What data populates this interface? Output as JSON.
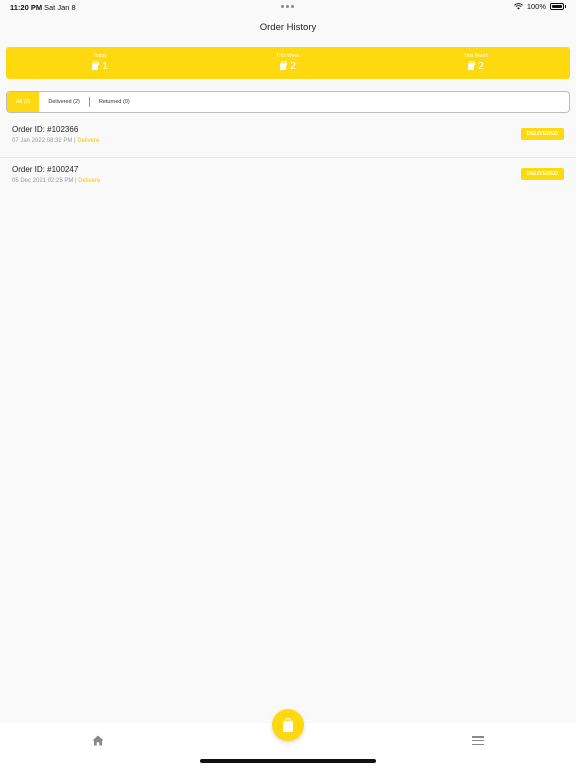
{
  "status_bar": {
    "time": "11:20 PM",
    "date": "Sat Jan 8",
    "battery": "100%"
  },
  "header": {
    "title": "Order History"
  },
  "stats": [
    {
      "label": "Today",
      "value": "1"
    },
    {
      "label": "This Week",
      "value": "2"
    },
    {
      "label": "This Month",
      "value": "2"
    }
  ],
  "tabs": [
    {
      "label": "All (2)",
      "active": true
    },
    {
      "label": "Delivered (2)",
      "active": false
    },
    {
      "label": "Returned (0)",
      "active": false
    }
  ],
  "orders": [
    {
      "id": "Order ID: #102366",
      "datetime": "07 Jan 2022   08:32 PM",
      "status_text": "Delivere",
      "badge": "DELIVERED"
    },
    {
      "id": "Order ID: #100247",
      "datetime": "05 Dec 2021   02:25 PM",
      "status_text": "Delivere",
      "badge": "DELIVERED"
    }
  ],
  "colors": {
    "accent": "#ffd90f",
    "background": "#f9f9f9"
  },
  "icons": {
    "home": "home-icon",
    "cart": "shopping-bag-icon",
    "menu": "menu-icon"
  }
}
